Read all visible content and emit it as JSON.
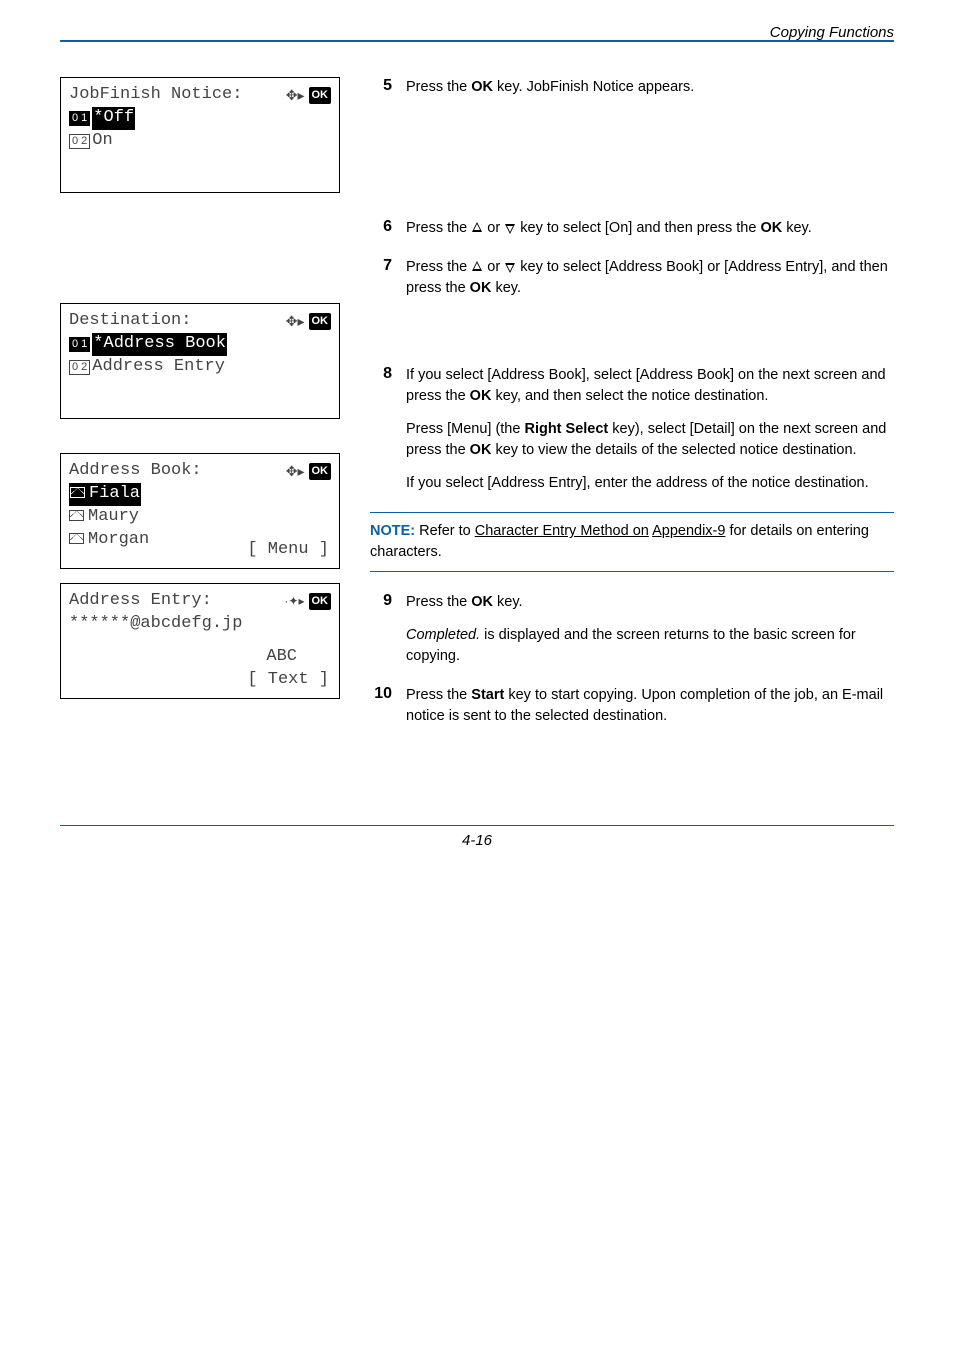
{
  "header": {
    "section_title": "Copying Functions"
  },
  "lcd1": {
    "title": "JobFinish Notice:",
    "indicator_arrows": "✦",
    "ok": "OK",
    "row1_num": "0 1",
    "row1_text": "*Off",
    "row2_num": "0 2",
    "row2_text": "On"
  },
  "lcd2": {
    "title": "Destination:",
    "ok": "OK",
    "row1_num": "0 1",
    "row1_text": "*Address Book",
    "row2_num": "0 2",
    "row2_text": "Address Entry"
  },
  "lcd3": {
    "title": "Address Book:",
    "ok": "OK",
    "row1_text": "Fiala",
    "row2_text": "Maury",
    "row3_text": "Morgan",
    "softkey": "[  Menu   ]"
  },
  "lcd4": {
    "title": "Address Entry:",
    "ok": "OK",
    "value": "******@abcdefg.jp",
    "mode": "ABC",
    "softkey": "[  Text   ]"
  },
  "steps": {
    "s5": {
      "num": "5",
      "text": "Press the OK key. JobFinish Notice appears."
    },
    "s6": {
      "num": "6",
      "pre": "Press the ",
      "mid": " or ",
      "post": " key to select [On] and then press the OK key."
    },
    "s7": {
      "num": "7",
      "pre": "Press the ",
      "mid": " or ",
      "post": " key to select [Address Book] or [Address Entry], and then press the OK key."
    },
    "s8": {
      "num": "8",
      "p1": "If you select [Address Book], select [Address Book] on the next screen and press the OK key, and then select the notice destination.",
      "p2": "Press [Menu] (the Right Select key), select [Detail] on the next screen and press the OK key to view the details of the selected notice destination.",
      "p3": "If you select [Address Entry], enter the address of the notice destination."
    },
    "s9": {
      "num": "9",
      "p1": "Press the OK key.",
      "p2": "Completed. is displayed and the screen returns to the basic screen for copying."
    },
    "s10": {
      "num": "10",
      "p1": "Press the Start key to start copying. Upon completion of the job, an E-mail notice is sent to the selected destination."
    }
  },
  "note": {
    "label": "NOTE:",
    "pre": " Refer to ",
    "link1": "Character Entry Method on",
    "link2": "Appendix-9",
    "post": " for details on entering characters."
  },
  "footer": {
    "page": "4-16"
  }
}
